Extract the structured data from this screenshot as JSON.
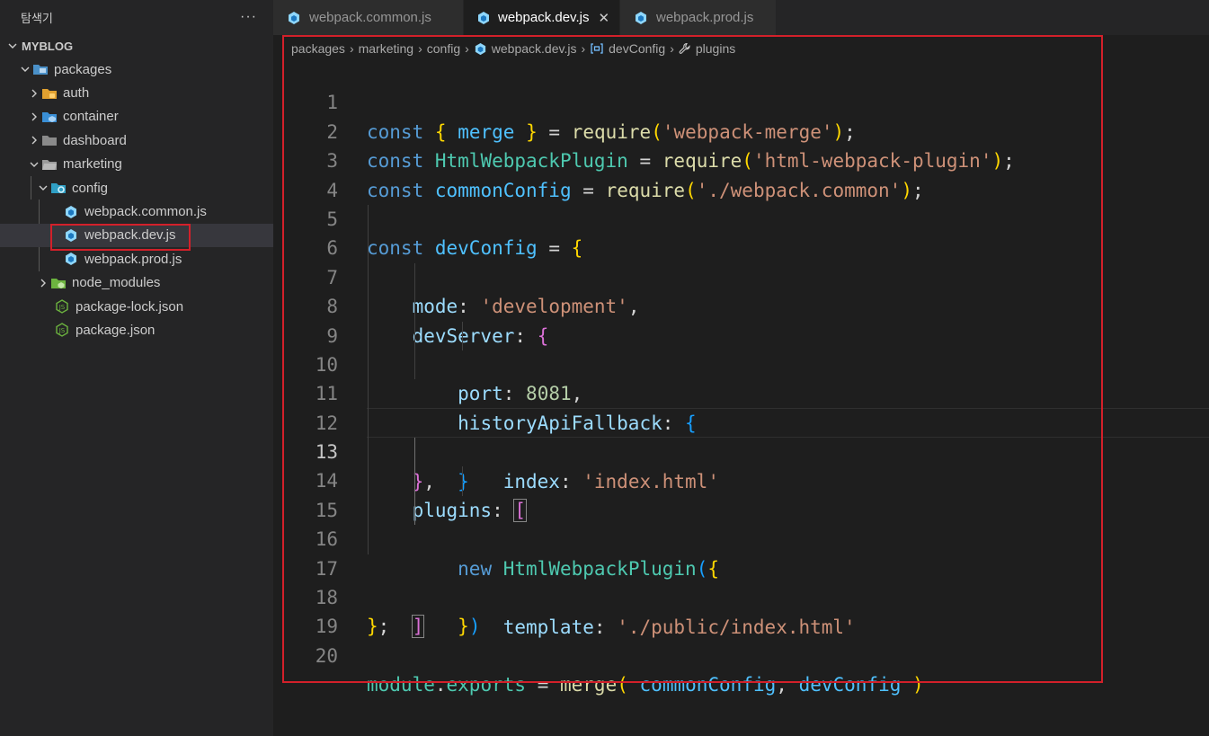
{
  "explorer": {
    "title": "탐색기",
    "more": "···",
    "root": "MYBLOG",
    "items": [
      {
        "label": "packages"
      },
      {
        "label": "auth"
      },
      {
        "label": "container"
      },
      {
        "label": "dashboard"
      },
      {
        "label": "marketing"
      },
      {
        "label": "config"
      },
      {
        "label": "webpack.common.js"
      },
      {
        "label": "webpack.dev.js"
      },
      {
        "label": "webpack.prod.js"
      },
      {
        "label": "node_modules"
      },
      {
        "label": "package-lock.json"
      },
      {
        "label": "package.json"
      }
    ]
  },
  "tabs": [
    {
      "label": "webpack.common.js"
    },
    {
      "label": "webpack.dev.js",
      "close": "✕"
    },
    {
      "label": "webpack.prod.js"
    }
  ],
  "breadcrumbs": [
    "packages",
    "marketing",
    "config",
    "webpack.dev.js",
    "devConfig",
    "plugins"
  ],
  "editor": {
    "line_numbers": [
      "1",
      "2",
      "3",
      "4",
      "5",
      "6",
      "7",
      "8",
      "9",
      "10",
      "11",
      "12",
      "13",
      "14",
      "15",
      "16",
      "17",
      "18",
      "19",
      "20"
    ],
    "current_line": "13",
    "tokens": {
      "const": "const",
      "new": "new",
      "merge": "merge",
      "require": "require",
      "HtmlWebpackPlugin": "HtmlWebpackPlugin",
      "commonConfig": "commonConfig",
      "devConfig": "devConfig",
      "module": "module",
      "exports": "exports",
      "mode": "mode",
      "devServer": "devServer",
      "port": "port",
      "historyApiFallback": "historyApiFallback",
      "index": "index",
      "plugins": "plugins",
      "template": "template",
      "str_merge": "'webpack-merge'",
      "str_html": "'html-webpack-plugin'",
      "str_common": "'./webpack.common'",
      "str_dev": "'development'",
      "str_index": "'index.html'",
      "str_public": "'./public/index.html'",
      "port_value": "8081"
    }
  },
  "colors": {
    "highlight_border": "#d3202a",
    "keyword": "#569cd6",
    "string": "#ce9178",
    "function": "#dcdcaa",
    "variable": "#4fc1ff",
    "property": "#9cdcfe"
  }
}
